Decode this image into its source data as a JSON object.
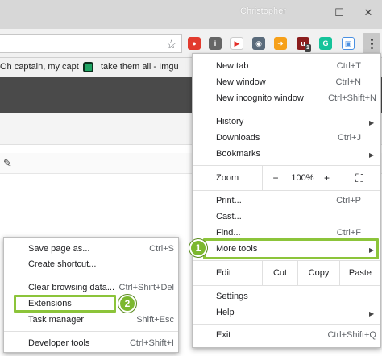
{
  "window": {
    "profile_name": "Christopher",
    "minimize_glyph": "—",
    "maximize_glyph": "☐",
    "close_glyph": "✕"
  },
  "toolbar": {
    "star_glyph": "☆",
    "extensions": [
      {
        "name": "opera-red-icon",
        "color": "#e23b2e",
        "glyph": "●"
      },
      {
        "name": "info-icon",
        "color": "#666666",
        "glyph": "i"
      },
      {
        "name": "play-icon",
        "color": "#ffffff",
        "glyph": "▶"
      },
      {
        "name": "shield-icon",
        "color": "#5a6b7b",
        "glyph": "◉"
      },
      {
        "name": "arrow-icon",
        "color": "#f6a01a",
        "glyph": "➜"
      },
      {
        "name": "ublock-icon",
        "color": "#8b1d1d",
        "glyph": "u"
      },
      {
        "name": "grammarly-icon",
        "color": "#15c39a",
        "glyph": "G"
      },
      {
        "name": "image-icon",
        "color": "#4a90e2",
        "glyph": "▣"
      }
    ],
    "ublock_count": "1"
  },
  "bookmarks": {
    "item1": "Oh captain, my capt",
    "item2": "take them all - Imgu"
  },
  "page": {
    "wand_glyph": "✎"
  },
  "main_menu": {
    "new_tab": {
      "label": "New tab",
      "shortcut": "Ctrl+T"
    },
    "new_window": {
      "label": "New window",
      "shortcut": "Ctrl+N"
    },
    "new_incognito": {
      "label": "New incognito window",
      "shortcut": "Ctrl+Shift+N"
    },
    "history": {
      "label": "History"
    },
    "downloads": {
      "label": "Downloads",
      "shortcut": "Ctrl+J"
    },
    "bookmarks": {
      "label": "Bookmarks"
    },
    "zoom": {
      "label": "Zoom",
      "minus": "−",
      "value": "100%",
      "plus": "+",
      "fullscreen": "⛶"
    },
    "print": {
      "label": "Print...",
      "shortcut": "Ctrl+P"
    },
    "cast": {
      "label": "Cast..."
    },
    "find": {
      "label": "Find...",
      "shortcut": "Ctrl+F"
    },
    "more_tools": {
      "label": "More tools"
    },
    "edit": {
      "label": "Edit",
      "cut": "Cut",
      "copy": "Copy",
      "paste": "Paste"
    },
    "settings": {
      "label": "Settings"
    },
    "help": {
      "label": "Help"
    },
    "exit": {
      "label": "Exit",
      "shortcut": "Ctrl+Shift+Q"
    },
    "arrow_glyph": "▶"
  },
  "sub_menu": {
    "save_page": {
      "label": "Save page as...",
      "shortcut": "Ctrl+S"
    },
    "create_shortcut": {
      "label": "Create shortcut..."
    },
    "clear_browsing": {
      "label": "Clear browsing data...",
      "shortcut": "Ctrl+Shift+Del"
    },
    "extensions": {
      "label": "Extensions"
    },
    "task_manager": {
      "label": "Task manager",
      "shortcut": "Shift+Esc"
    },
    "developer_tools": {
      "label": "Developer tools",
      "shortcut": "Ctrl+Shift+I"
    }
  },
  "callouts": {
    "step1": "1",
    "step2": "2",
    "highlight_color": "#8cc43a"
  }
}
